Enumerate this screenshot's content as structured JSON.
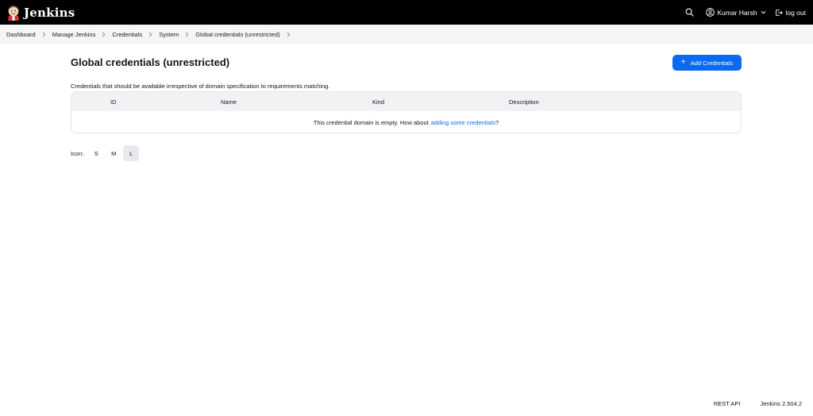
{
  "header": {
    "brand": "Jenkins",
    "user_name": "Kumar Harsh",
    "logout_label": "log out",
    "icons": [
      "jenkins-logo",
      "search-icon",
      "user-icon",
      "chevron-down-icon",
      "logout-icon"
    ]
  },
  "breadcrumb": {
    "items": [
      "Dashboard",
      "Manage Jenkins",
      "Credentials",
      "System",
      "Global credentials (unrestricted)"
    ]
  },
  "main": {
    "title": "Global credentials (unrestricted)",
    "add_button_label": "Add Credentials",
    "description": "Credentials that should be available irrespective of domain specification to requirements matching.",
    "table": {
      "columns": [
        "ID",
        "Name",
        "Kind",
        "Description"
      ],
      "empty_text": "This credential domain is empty. How about",
      "empty_link": "adding some credentials",
      "empty_suffix": "?"
    },
    "icon_size": {
      "label": "Icon:",
      "options": [
        "S",
        "M",
        "L"
      ],
      "selected": "L"
    }
  },
  "footer": {
    "rest_api": "REST API",
    "version": "Jenkins 2.504.2"
  },
  "colors": {
    "header_bg": "#000000",
    "accent": "#0b6bf0",
    "crumb_bg": "#f5f5f6"
  }
}
